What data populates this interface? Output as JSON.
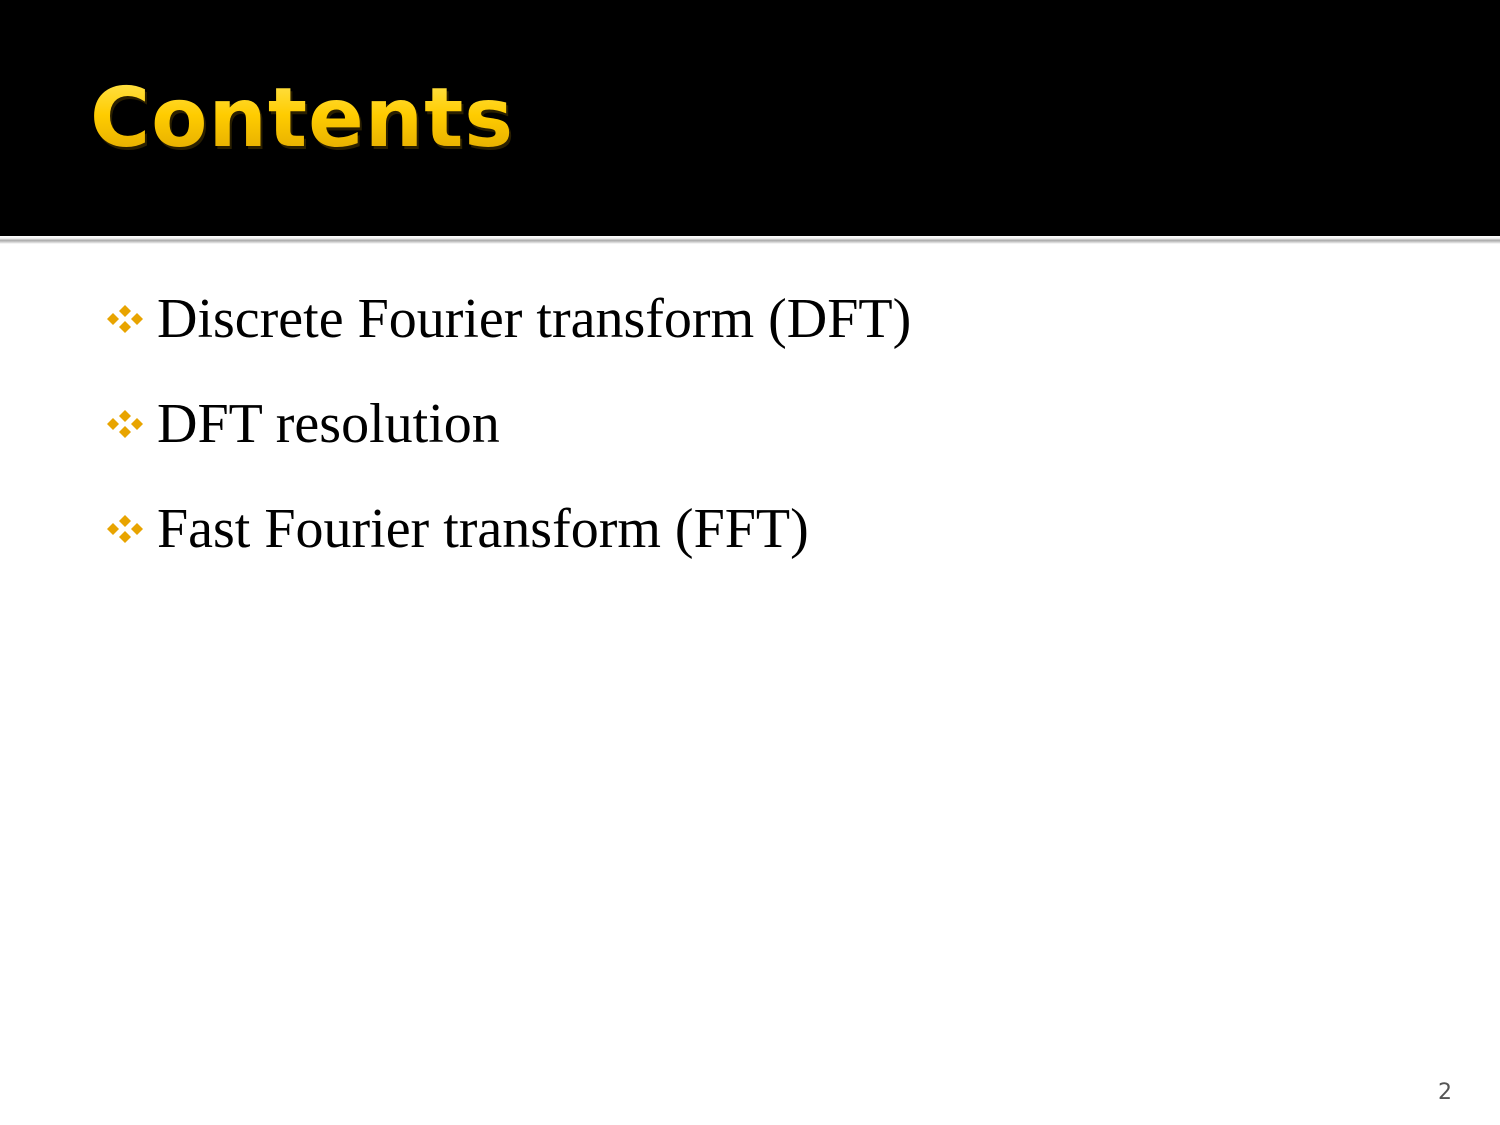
{
  "slide": {
    "title": "Contents",
    "bullets": [
      {
        "label": "Discrete Fourier transform (DFT)",
        "icon": "diamond-bullet-icon"
      },
      {
        "label": "DFT resolution",
        "icon": "diamond-bullet-icon"
      },
      {
        "label": "Fast Fourier transform (FFT)",
        "icon": "diamond-bullet-icon"
      }
    ],
    "page_number": "2"
  },
  "colors": {
    "title_bar": "#000000",
    "title_text": "#FFCC00",
    "bullet_icon": "#E8A400",
    "body_text": "#000000",
    "background": "#FFFFFF"
  }
}
